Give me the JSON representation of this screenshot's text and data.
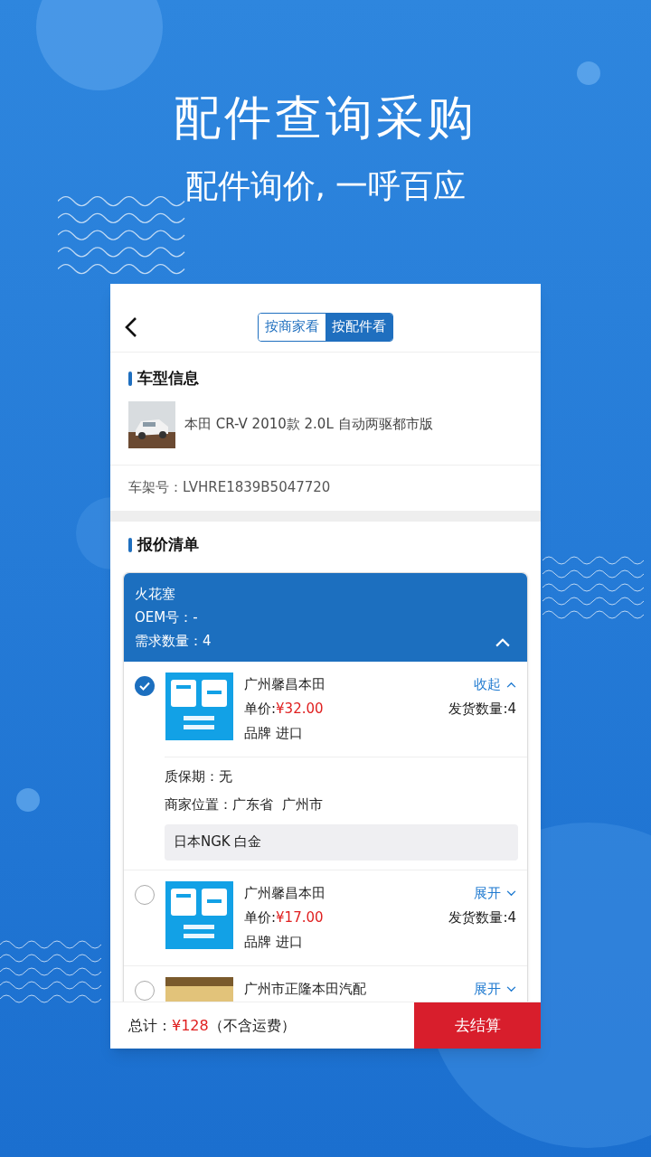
{
  "hero": {
    "title": "配件查询采购",
    "subtitle": "配件询价, 一呼百应"
  },
  "view_tabs": [
    {
      "label": "按商家看",
      "selected": false
    },
    {
      "label": "按配件看",
      "selected": true
    }
  ],
  "vehicle": {
    "section_title": "车型信息",
    "model": "本田 CR-V 2010款 2.0L 自动两驱都市版",
    "vin": "车架号：LVHRE1839B5047720"
  },
  "quote": {
    "section_title": "报价清单",
    "part": {
      "name": "火花塞",
      "oem": "OEM号：-",
      "quantity": "需求数量：4",
      "expanded": true
    },
    "offers": [
      {
        "seller": "广州馨昌本田",
        "price_label": "单价:",
        "price": "¥32.00",
        "brand": "品牌 进口",
        "shipping": "发货数量:4",
        "toggle": "收起",
        "expanded": true,
        "selected": true,
        "warranty": "质保期：无",
        "location": "商家位置：广东省  广州市",
        "note": "日本NGK 白金"
      },
      {
        "seller": "广州馨昌本田",
        "price_label": "单价:",
        "price": "¥17.00",
        "brand": "品牌 进口",
        "shipping": "发货数量:4",
        "toggle": "展开",
        "expanded": false,
        "selected": false
      },
      {
        "seller": "广州市正隆本田汽配",
        "toggle": "展开",
        "expanded": false,
        "selected": false
      }
    ]
  },
  "footer": {
    "total_label": "总计：",
    "total": "¥128",
    "total_note": "（不含运费）",
    "checkout": "去结算"
  }
}
